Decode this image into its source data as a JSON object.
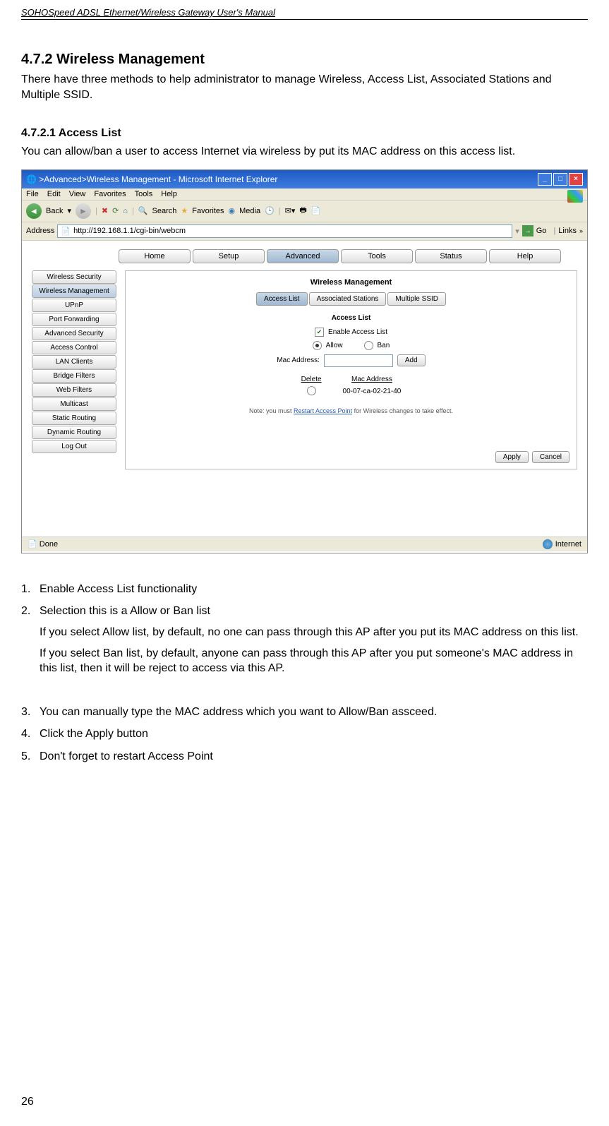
{
  "header": "SOHOSpeed ADSL Ethernet/Wireless Gateway User's Manual",
  "section_h2": "4.7.2  Wireless Management",
  "section_h2_body": "There have three methods to help administrator to manage Wireless, Access List, Associated Stations and Multiple SSID.",
  "section_h3": "4.7.2.1  Access List",
  "section_h3_body": "You can allow/ban a user to access Internet via wireless by put its MAC address on this access list.",
  "steps": {
    "n1": "1.",
    "t1": "Enable Access List functionality",
    "n2": "2.",
    "t2": "Selection this is a Allow or Ban list",
    "t2a": "If you select Allow list, by default, no one can pass through this AP after you put its MAC address on this list.",
    "t2b": "If you select Ban list, by default, anyone can pass through this AP after you put someone's MAC address in this list, then it will be reject to access via this AP.",
    "n3": "3.",
    "t3": "You can manually type the MAC address which you want to Allow/Ban assceed.",
    "n4": "4.",
    "t4": "Click the Apply button",
    "n5": "5.",
    "t5": "Don't forget to restart Access Point"
  },
  "page_number": "26",
  "ie": {
    "title": ">Advanced>Wireless Management - Microsoft Internet Explorer",
    "menu": {
      "file": "File",
      "edit": "Edit",
      "view": "View",
      "favorites": "Favorites",
      "tools": "Tools",
      "help": "Help"
    },
    "toolbar": {
      "back": "Back",
      "search": "Search",
      "favorites": "Favorites",
      "media": "Media"
    },
    "addr_label": "Address",
    "addr_value": "http://192.168.1.1/cgi-bin/webcm",
    "go": "Go",
    "links": "Links",
    "status_done": "Done",
    "status_zone": "Internet"
  },
  "nav": {
    "home": "Home",
    "setup": "Setup",
    "advanced": "Advanced",
    "tools": "Tools",
    "status": "Status",
    "help": "Help"
  },
  "sidebar": {
    "items": [
      "Wireless Security",
      "Wireless Management",
      "UPnP",
      "Port Forwarding",
      "Advanced Security",
      "Access Control",
      "LAN Clients",
      "Bridge Filters",
      "Web Filters",
      "Multicast",
      "Static Routing",
      "Dynamic Routing",
      "Log Out"
    ]
  },
  "panel": {
    "title": "Wireless Management",
    "subtabs": {
      "access": "Access List",
      "assoc": "Associated Stations",
      "mssid": "Multiple SSID"
    },
    "section": "Access List",
    "enable": "Enable Access List",
    "allow": "Allow",
    "ban": "Ban",
    "mac_label": "Mac Address:",
    "add": "Add",
    "col_delete": "Delete",
    "col_mac": "Mac Address",
    "mac_entry": "00-07-ca-02-21-40",
    "note_pre": "Note: you must ",
    "note_link": "Restart Access Point",
    "note_post": " for Wireless changes to take effect.",
    "apply": "Apply",
    "cancel": "Cancel"
  }
}
